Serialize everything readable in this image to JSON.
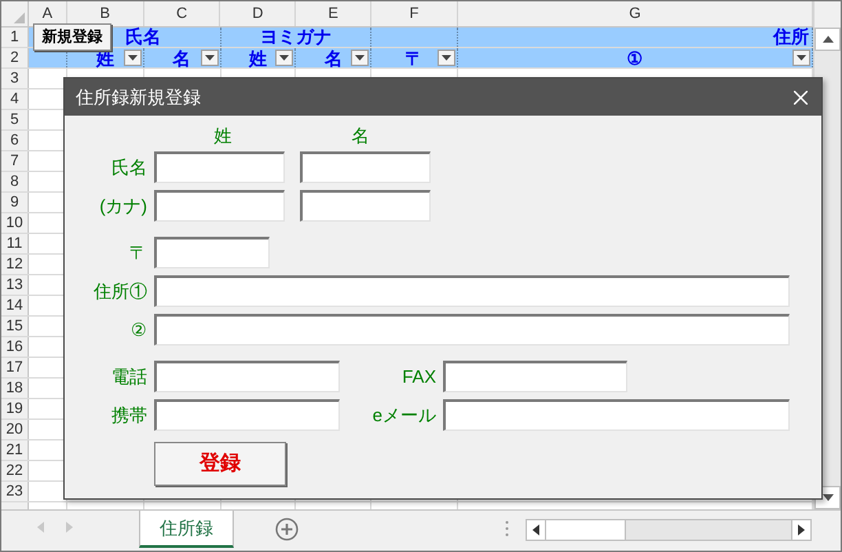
{
  "sheet": {
    "columns": [
      "A",
      "B",
      "C",
      "D",
      "E",
      "F",
      "G"
    ],
    "rows": [
      "1",
      "2",
      "3",
      "4",
      "5",
      "6",
      "7",
      "8",
      "9",
      "10",
      "11",
      "12",
      "13",
      "14",
      "15",
      "16",
      "17",
      "18",
      "19",
      "20",
      "21",
      "22",
      "23"
    ],
    "header_row_1": [
      {
        "kind": "single"
      },
      {
        "kind": "merged",
        "text": "氏名"
      },
      {
        "kind": "merged",
        "text": "ヨミガナ"
      },
      {
        "kind": "single"
      },
      {
        "kind": "single",
        "text": "住所"
      }
    ],
    "header_row_2": [
      {
        "filter": false
      },
      {
        "text": "姓",
        "filter": true
      },
      {
        "text": "名",
        "filter": true
      },
      {
        "text": "姓",
        "filter": true
      },
      {
        "text": "名",
        "filter": true
      },
      {
        "text": "〒",
        "filter": true
      },
      {
        "text": "①",
        "filter": true
      }
    ]
  },
  "new_button": {
    "label": "新規登録"
  },
  "dialog": {
    "title": "住所録新規登録",
    "column_labels": [
      "姓",
      "名"
    ],
    "rows": [
      {
        "kind": "pair",
        "label": "氏名"
      },
      {
        "kind": "pair",
        "label": "(カナ)"
      },
      {
        "kind": "short",
        "label": "〒"
      },
      {
        "kind": "wide",
        "label": "住所①"
      },
      {
        "kind": "wide",
        "label": "②"
      },
      {
        "kind": "split",
        "label": "電話",
        "label_2": "FAX",
        "second_wide": false
      },
      {
        "kind": "split",
        "label": "携帯",
        "label_2": "eメール",
        "second_wide": true
      }
    ],
    "submit": "登録"
  },
  "sheet_tabs": [
    {
      "label": "住所録",
      "selected": true
    }
  ]
}
